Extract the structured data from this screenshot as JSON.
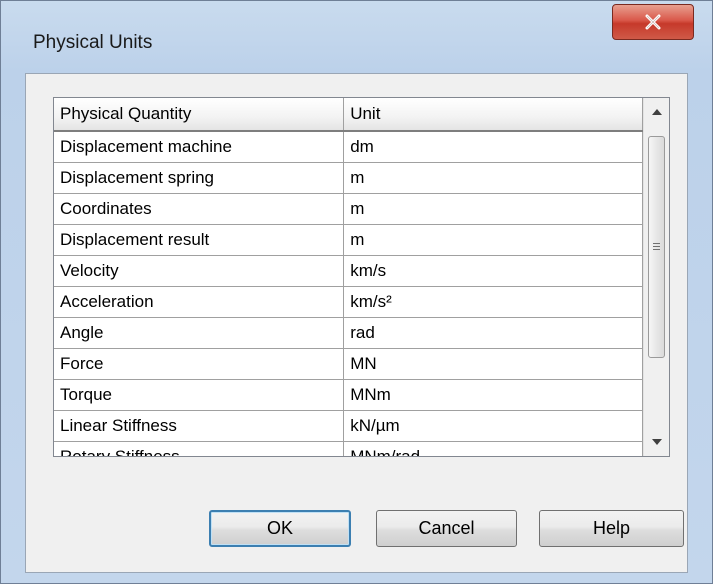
{
  "window": {
    "title": "Physical Units",
    "close_label": "X"
  },
  "grid": {
    "columns": [
      "Physical Quantity",
      "Unit"
    ],
    "rows": [
      [
        "Displacement machine",
        "dm"
      ],
      [
        "Displacement spring",
        "m"
      ],
      [
        "Coordinates",
        "m"
      ],
      [
        "Displacement result",
        "m"
      ],
      [
        "Velocity",
        "km/s"
      ],
      [
        "Acceleration",
        "km/s²"
      ],
      [
        "Angle",
        "rad"
      ],
      [
        "Force",
        "MN"
      ],
      [
        "Torque",
        "MNm"
      ],
      [
        "Linear Stiffness",
        "kN/µm"
      ],
      [
        "Rotary Stiffness",
        "MNm/rad"
      ]
    ]
  },
  "buttons": {
    "ok": "OK",
    "cancel": "Cancel",
    "help": "Help"
  },
  "icons": {
    "close": "close-icon",
    "scroll_up": "arrow-up-icon",
    "scroll_down": "arrow-down-icon"
  },
  "colors": {
    "frame": "#bcd1ea",
    "close_button": "#c6392a",
    "default_button_border": "#3c7fb1"
  }
}
